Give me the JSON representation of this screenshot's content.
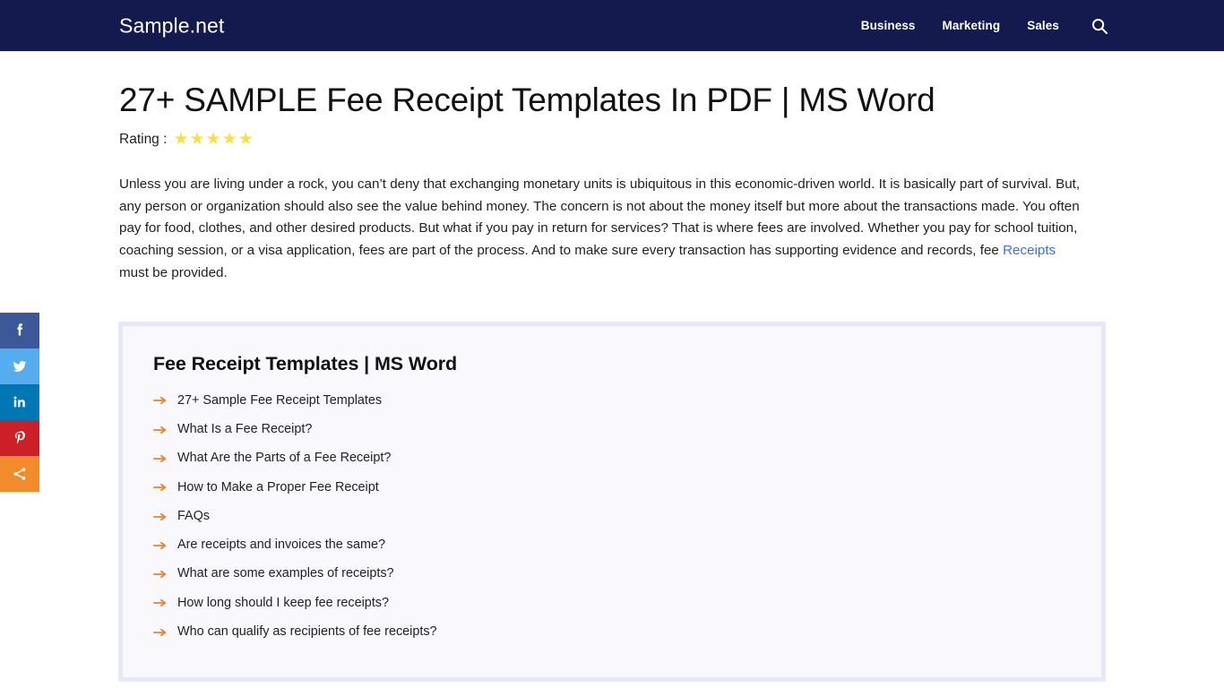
{
  "navbar": {
    "brand": "Sample.net",
    "links": [
      {
        "label": "Business"
      },
      {
        "label": "Marketing"
      },
      {
        "label": "Sales"
      }
    ],
    "search_icon": "search-icon",
    "background_color": "#141a4e"
  },
  "social": {
    "items": [
      {
        "name": "facebook",
        "label": "Facebook",
        "color": "#3b5998"
      },
      {
        "name": "twitter",
        "label": "Twitter",
        "color": "#55acee"
      },
      {
        "name": "linkedin",
        "label": "LinkedIn",
        "color": "#0077b5"
      },
      {
        "name": "pinterest",
        "label": "Pinterest",
        "color": "#cb2027"
      },
      {
        "name": "share",
        "label": "Share",
        "color": "#f28b2c"
      }
    ]
  },
  "article": {
    "title": "27+ SAMPLE Fee Receipt Templates In PDF | MS Word",
    "rating_label": "Rating :",
    "rating_value": 5,
    "rating_star_glyph": "★",
    "rating_star_color": "#f7df4a",
    "intro_part_1": "Unless you are living under a rock, you can’t deny that exchanging monetary units is ubiquitous in this economic-driven world. It is basically part of survival. But, any person or organization should also see the value behind money. The concern is not about the money itself but more about the transactions made. You often pay for food, clothes, and other desired products. But what if you pay in return for services? That is where fees are involved. Whether you pay for school tuition, coaching session, or a visa application, fees are part of the process. And to make sure every transaction has supporting evidence and records, fee ",
    "intro_link": "Receipts",
    "intro_link_color": "#3f6fd8",
    "intro_part_2": " must be provided."
  },
  "toc": {
    "title": "Fee Receipt Templates | MS Word",
    "bullet_icon": "arrow-right-icon",
    "bullet_color": "#e8822a",
    "items": [
      {
        "label": "27+ Sample Fee Receipt Templates"
      },
      {
        "label": "What Is a Fee Receipt?"
      },
      {
        "label": "What Are the Parts of a Fee Receipt?"
      },
      {
        "label": "How to Make a Proper Fee Receipt"
      },
      {
        "label": "FAQs"
      },
      {
        "label": "Are receipts and invoices the same?"
      },
      {
        "label": "What are some examples of receipts?"
      },
      {
        "label": "How long should I keep fee receipts?"
      },
      {
        "label": "Who can qualify as recipients of fee receipts?"
      }
    ]
  }
}
